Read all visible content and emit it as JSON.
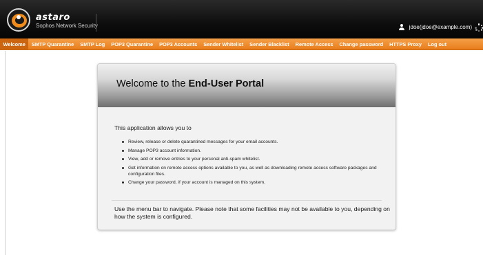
{
  "brand": {
    "name": "astaro",
    "subtitle": "Sophos Network Security"
  },
  "user": {
    "label": "jdoe(jdoe@example.com)"
  },
  "nav": {
    "items": [
      {
        "label": "Welcome",
        "active": true
      },
      {
        "label": "SMTP Quarantine"
      },
      {
        "label": "SMTP Log"
      },
      {
        "label": "POP3 Quarantine"
      },
      {
        "label": "POP3 Accounts"
      },
      {
        "label": "Sender Whitelist"
      },
      {
        "label": "Sender Blacklist"
      },
      {
        "label": "Remote Access"
      },
      {
        "label": "Change password"
      },
      {
        "label": "HTTPS Proxy"
      },
      {
        "label": "Log out"
      }
    ]
  },
  "panel": {
    "title_prefix": "Welcome to the ",
    "title_bold": "End-User Portal",
    "intro": "This application allows you to",
    "bullets": [
      "Review, release or delete quarantined messages for your email accounts.",
      "Manage POP3 account information.",
      "View, add or remove entries to your personal anti-spam whitelist.",
      "Get information on remote access options available to you, as well as downloading remote access software packages and configuration files.",
      "Change your password, if your account is managed on this system."
    ],
    "footer": "Use the menu bar to navigate. Please note that some facilities may not be available to you, depending on how the system is configured."
  },
  "colors": {
    "nav_orange": "#ee8a2a",
    "nav_active": "#cc6510",
    "topbar": "#0e0e0e",
    "brand_accent": "#f08c1e"
  },
  "icons": {
    "logo": "astaro-logo-icon",
    "user": "user-icon",
    "spinner": "loading-spinner-icon"
  }
}
